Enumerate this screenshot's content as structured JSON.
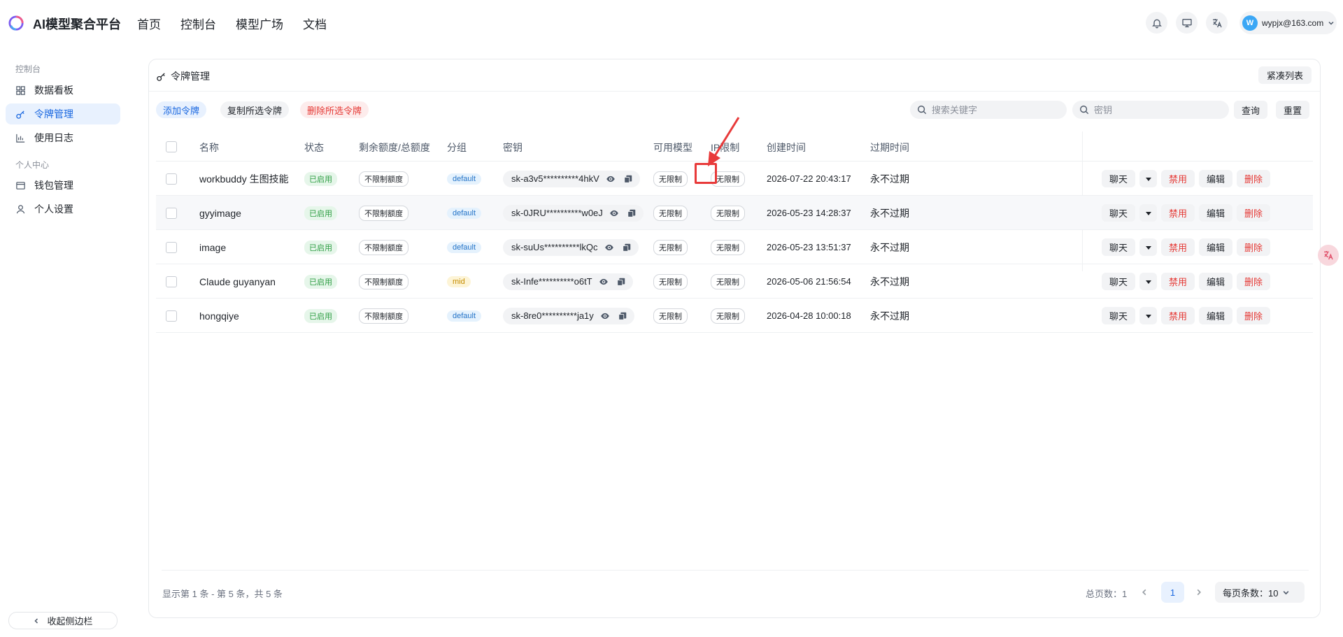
{
  "app": {
    "name": "AI模型聚合平台"
  },
  "nav": {
    "items": [
      "首页",
      "控制台",
      "模型广场",
      "文档"
    ]
  },
  "user": {
    "avatar_letter": "W",
    "email": "wypjx@163.com"
  },
  "sidebar": {
    "section1": "控制台",
    "section2": "个人中心",
    "items": [
      {
        "label": "数据看板",
        "icon": "dashboard-icon"
      },
      {
        "label": "令牌管理",
        "icon": "key-icon",
        "active": true
      },
      {
        "label": "使用日志",
        "icon": "chart-icon"
      },
      {
        "label": "钱包管理",
        "icon": "wallet-icon"
      },
      {
        "label": "个人设置",
        "icon": "user-icon"
      }
    ],
    "collapse_label": "收起侧边栏"
  },
  "page": {
    "title": "令牌管理",
    "compact_label": "紧凑列表",
    "add_label": "添加令牌",
    "copy_selected_label": "复制所选令牌",
    "delete_selected_label": "删除所选令牌",
    "search_placeholder": "搜索关键字",
    "key_placeholder": "密钥",
    "query_label": "查询",
    "reset_label": "重置"
  },
  "table": {
    "columns": [
      "名称",
      "状态",
      "剩余额度/总额度",
      "分组",
      "密钥",
      "可用模型",
      "IP限制",
      "创建时间",
      "过期时间"
    ],
    "rows": [
      {
        "name": "workbuddy 生图技能",
        "status": "已启用",
        "quota": "不限制额度",
        "group": "default",
        "key": "sk-a3v5**********4hkV",
        "models": "无限制",
        "ip": "无限制",
        "created": "2026-07-22 20:43:17",
        "expires": "永不过期"
      },
      {
        "name": "gyyimage",
        "status": "已启用",
        "quota": "不限制额度",
        "group": "default",
        "key": "sk-0JRU**********w0eJ",
        "models": "无限制",
        "ip": "无限制",
        "created": "2026-05-23 14:28:37",
        "expires": "永不过期"
      },
      {
        "name": "image",
        "status": "已启用",
        "quota": "不限制额度",
        "group": "default",
        "key": "sk-suUs**********lkQc",
        "models": "无限制",
        "ip": "无限制",
        "created": "2026-05-23 13:51:37",
        "expires": "永不过期"
      },
      {
        "name": "Claude guyanyan",
        "status": "已启用",
        "quota": "不限制额度",
        "group": "mid",
        "key": "sk-Infe**********o6tT",
        "models": "无限制",
        "ip": "无限制",
        "created": "2026-05-06 21:56:54",
        "expires": "永不过期"
      },
      {
        "name": "hongqiye",
        "status": "已启用",
        "quota": "不限制额度",
        "group": "default",
        "key": "sk-8re0**********ja1y",
        "models": "无限制",
        "ip": "无限制",
        "created": "2026-04-28 10:00:18",
        "expires": "永不过期"
      }
    ],
    "actions": {
      "chat": "聊天",
      "disable": "禁用",
      "edit": "编辑",
      "delete": "删除"
    }
  },
  "footer": {
    "summary": "显示第 1 条 - 第 5 条，共 5 条",
    "total_pages": "总页数：1",
    "current_page": "1",
    "page_size": "每页条数：10"
  },
  "colors": {
    "accent": "#1967e0",
    "danger": "#e53935",
    "success": "#2f9e44",
    "annotation": "#e83a3a"
  }
}
